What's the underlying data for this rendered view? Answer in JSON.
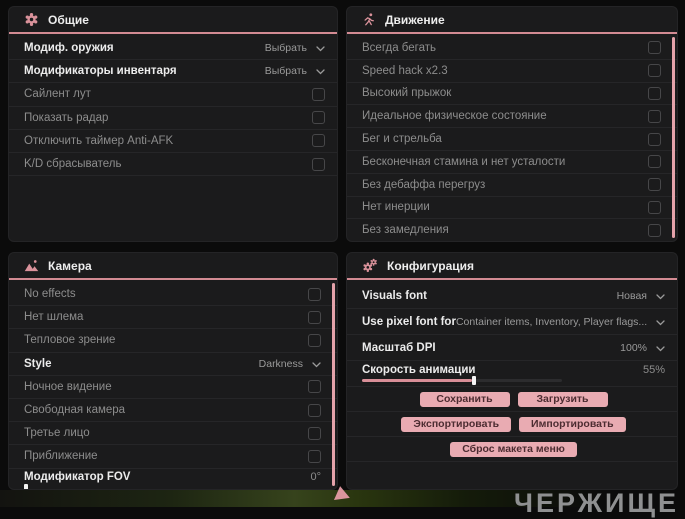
{
  "colors": {
    "accent": "#d98f98",
    "panel_background": "#1b1b1c",
    "button_background": "#e9abb2",
    "button_text": "#4c2c31",
    "scrollbar": "#e4a2aa"
  },
  "panels": [
    {
      "id": "general",
      "title": "Общие",
      "icon": "gear-icon",
      "scrollbar": false,
      "rows": [
        {
          "type": "dropdown",
          "label": "Модиф. оружия",
          "value": "Выбрать"
        },
        {
          "type": "dropdown",
          "label": "Модификаторы инвентаря",
          "value": "Выбрать"
        },
        {
          "type": "checkbox",
          "label": "Сайлент лут",
          "checked": false
        },
        {
          "type": "checkbox",
          "label": "Показать радар",
          "checked": false
        },
        {
          "type": "checkbox",
          "label": "Отключить таймер Anti-AFK",
          "checked": false
        },
        {
          "type": "checkbox",
          "label": "K/D сбрасыватель",
          "checked": false
        }
      ]
    },
    {
      "id": "movement",
      "title": "Движение",
      "icon": "runner-icon",
      "scrollbar": true,
      "rows": [
        {
          "type": "checkbox",
          "label": "Всегда бегать",
          "checked": false
        },
        {
          "type": "checkbox",
          "label": "Speed hack x2.3",
          "checked": false
        },
        {
          "type": "checkbox",
          "label": "Высокий прыжок",
          "checked": false
        },
        {
          "type": "checkbox",
          "label": "Идеальное физическое состояние",
          "checked": false
        },
        {
          "type": "checkbox",
          "label": "Бег и стрельба",
          "checked": false
        },
        {
          "type": "checkbox",
          "label": "Бесконечная стамина и нет усталости",
          "checked": false
        },
        {
          "type": "checkbox",
          "label": "Без дебаффа перегруз",
          "checked": false
        },
        {
          "type": "checkbox",
          "label": "Нет инерции",
          "checked": false
        },
        {
          "type": "checkbox",
          "label": "Без замедления",
          "checked": false
        }
      ]
    },
    {
      "id": "camera",
      "title": "Камера",
      "icon": "image-icon",
      "scrollbar": true,
      "rows": [
        {
          "type": "checkbox",
          "label": "No effects",
          "checked": false
        },
        {
          "type": "checkbox",
          "label": "Нет шлема",
          "checked": false
        },
        {
          "type": "checkbox",
          "label": "Тепловое зрение",
          "checked": false
        },
        {
          "type": "dropdown",
          "label": "Style",
          "value": "Darkness"
        },
        {
          "type": "checkbox",
          "label": "Ночное видение",
          "checked": false
        },
        {
          "type": "checkbox",
          "label": "Свободная камера",
          "checked": false
        },
        {
          "type": "checkbox",
          "label": "Третье лицо",
          "checked": false
        },
        {
          "type": "checkbox",
          "label": "Приближение",
          "checked": false
        },
        {
          "type": "slider",
          "label": "Модификатор FOV",
          "value": "0°",
          "percent": 0
        }
      ]
    },
    {
      "id": "config",
      "title": "Конфигурация",
      "icon": "gears-icon",
      "scrollbar": false,
      "rows": [
        {
          "type": "dropdown",
          "label": "Visuals font",
          "value": "Новая"
        },
        {
          "type": "dropdown",
          "label": "Use pixel font for",
          "value": "Container items, Inventory, Player flags..."
        },
        {
          "type": "dropdown",
          "label": "Масштаб DPI",
          "value": "100%"
        },
        {
          "type": "slider",
          "label": "Скорость анимации",
          "value": "55%",
          "percent": 55
        },
        {
          "type": "buttons",
          "buttons": [
            {
              "label": "Сохранить",
              "name": "save-button"
            },
            {
              "label": "Загрузить",
              "name": "load-button"
            }
          ]
        },
        {
          "type": "buttons",
          "buttons": [
            {
              "label": "Экспортировать",
              "name": "export-button"
            },
            {
              "label": "Импортировать",
              "name": "import-button"
            }
          ]
        },
        {
          "type": "buttons",
          "buttons": [
            {
              "label": "Сброс макета меню",
              "name": "reset-menu-layout-button"
            }
          ]
        }
      ]
    }
  ],
  "background": {
    "partial_text": "ЧЕРЖИЩЕ"
  }
}
